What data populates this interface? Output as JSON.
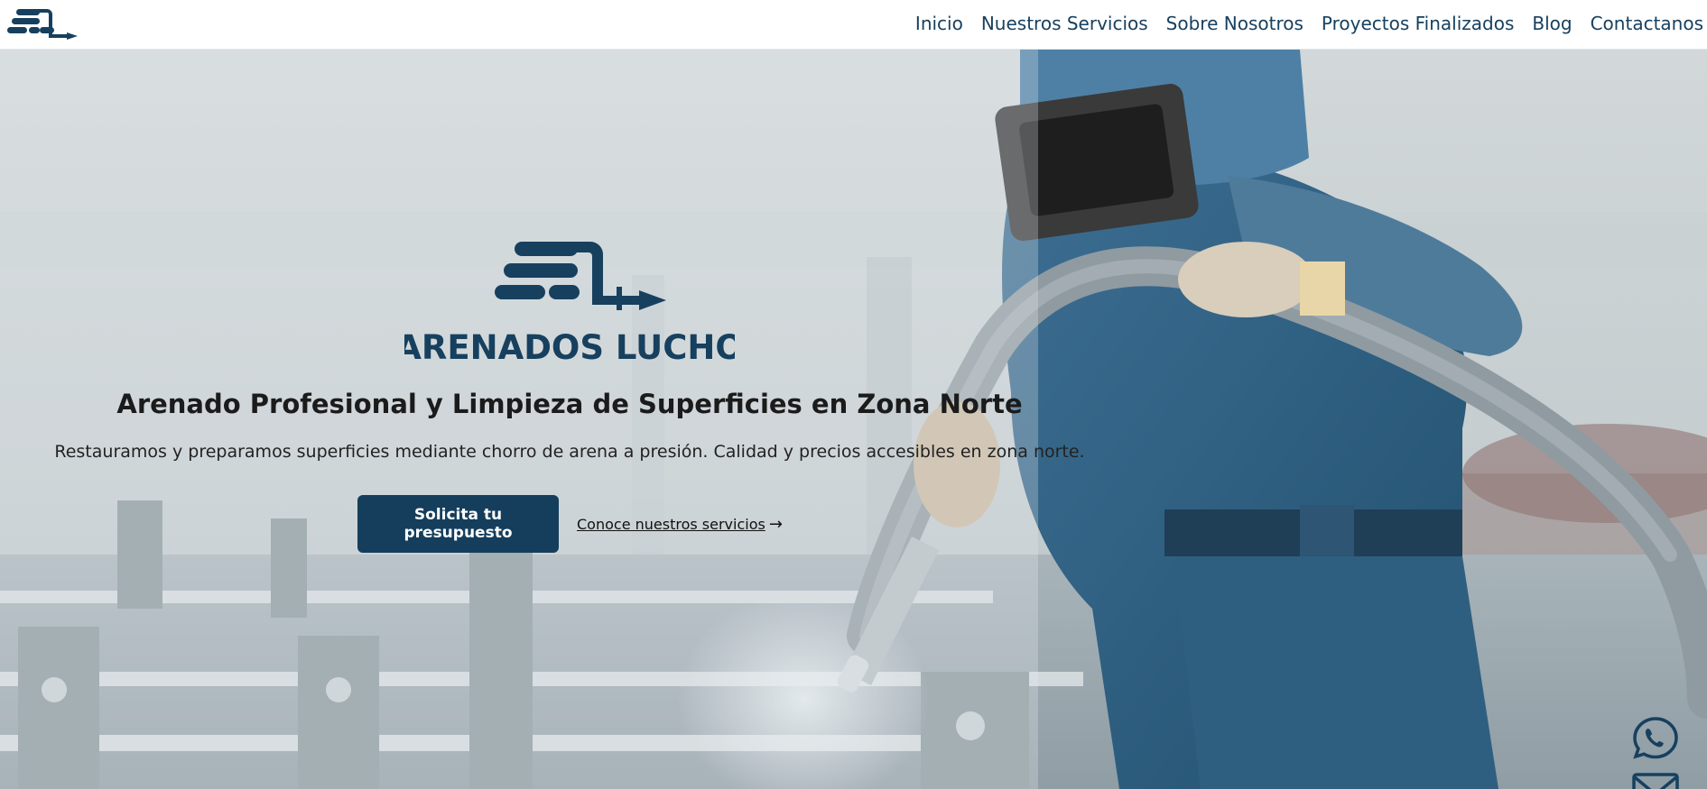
{
  "brand": {
    "name": "ARENADOS LUCHO",
    "color": "#17405f",
    "logo_icon": "sandblasting-logo-icon"
  },
  "nav": {
    "items": [
      {
        "label": "Inicio"
      },
      {
        "label": "Nuestros Servicios"
      },
      {
        "label": "Sobre Nosotros"
      },
      {
        "label": "Proyectos Finalizados"
      },
      {
        "label": "Blog"
      },
      {
        "label": "Contactanos"
      }
    ]
  },
  "hero": {
    "title": "Arenado Profesional y Limpieza de Superficies en Zona Norte",
    "subtitle": "Restauramos y preparamos superficies mediante chorro de arena a presión. Calidad y precios accesibles en zona norte.",
    "primary_cta": "Solicita tu presupuesto",
    "secondary_cta": "Conoce nuestros servicios",
    "secondary_icon": "arrow-right-icon",
    "image_subject": "worker-sandblasting-photo"
  },
  "floating": {
    "whatsapp_icon": "whatsapp-icon",
    "mail_icon": "mail-icon"
  },
  "colors": {
    "primary": "#153e5c",
    "text": "#1b1b1b"
  }
}
